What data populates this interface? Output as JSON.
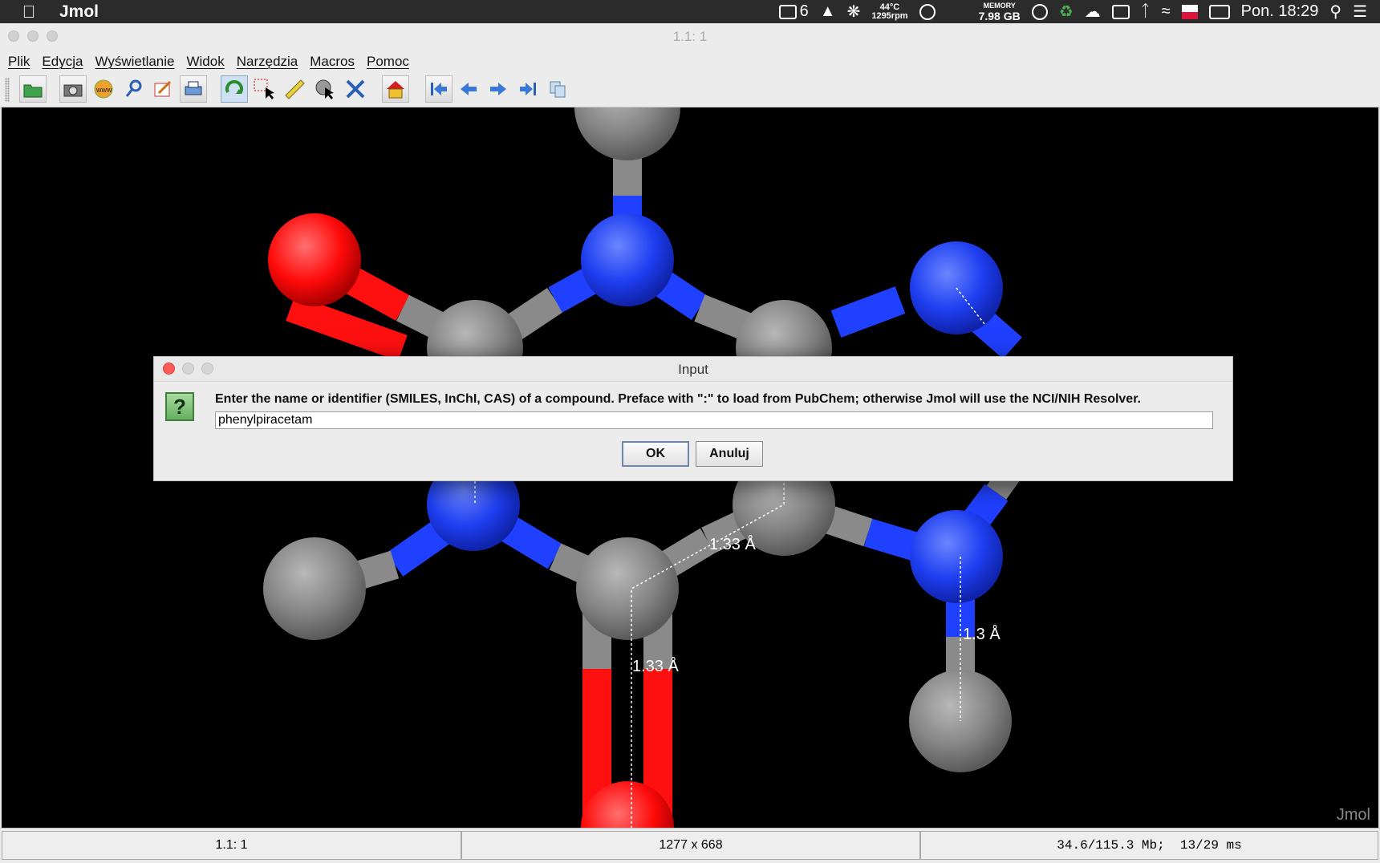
{
  "menubar": {
    "app_name": "Jmol",
    "notification_count": "6",
    "temp": "44°C",
    "fan": "1295rpm",
    "memory_label": "MEMORY",
    "memory_value": "7.98 GB",
    "clock": "Pon. 18:29"
  },
  "window": {
    "title": "1.1: 1"
  },
  "menu": {
    "items": [
      "Plik",
      "Edycja",
      "Wyświetlanie",
      "Widok",
      "Narzędzia",
      "Macros",
      "Pomoc"
    ]
  },
  "toolbar": {
    "icons": [
      "open-icon",
      "camera-icon",
      "www-icon",
      "key-icon",
      "edit-icon",
      "print-icon",
      "rotate-icon",
      "select-icon",
      "ruler-icon",
      "pick-icon",
      "spin-icon",
      "home-icon",
      "first-frame-icon",
      "prev-frame-icon",
      "next-frame-icon",
      "last-frame-icon",
      "copy-frames-icon"
    ],
    "active": "rotate-icon"
  },
  "viewer": {
    "watermark": "Jmol",
    "measurements": [
      "1.33 Å",
      "1.33 Å",
      "1.3 Å"
    ],
    "atom_colors": {
      "carbon": "#8a8a8a",
      "nitrogen": "#2040ff",
      "oxygen": "#ff1010"
    }
  },
  "dialog": {
    "title": "Input",
    "prompt": "Enter the name or identifier (SMILES, InChI, CAS) of a compound. Preface with \":\" to load from PubChem; otherwise Jmol will use the NCI/NIH Resolver.",
    "input_value": "phenylpiracetam",
    "ok_label": "OK",
    "cancel_label": "Anuluj",
    "icon_glyph": "?"
  },
  "statusbar": {
    "frame": "1.1: 1",
    "size": "1277 x 668",
    "stats": "34.6/115.3 Mb;  13/29 ms"
  }
}
